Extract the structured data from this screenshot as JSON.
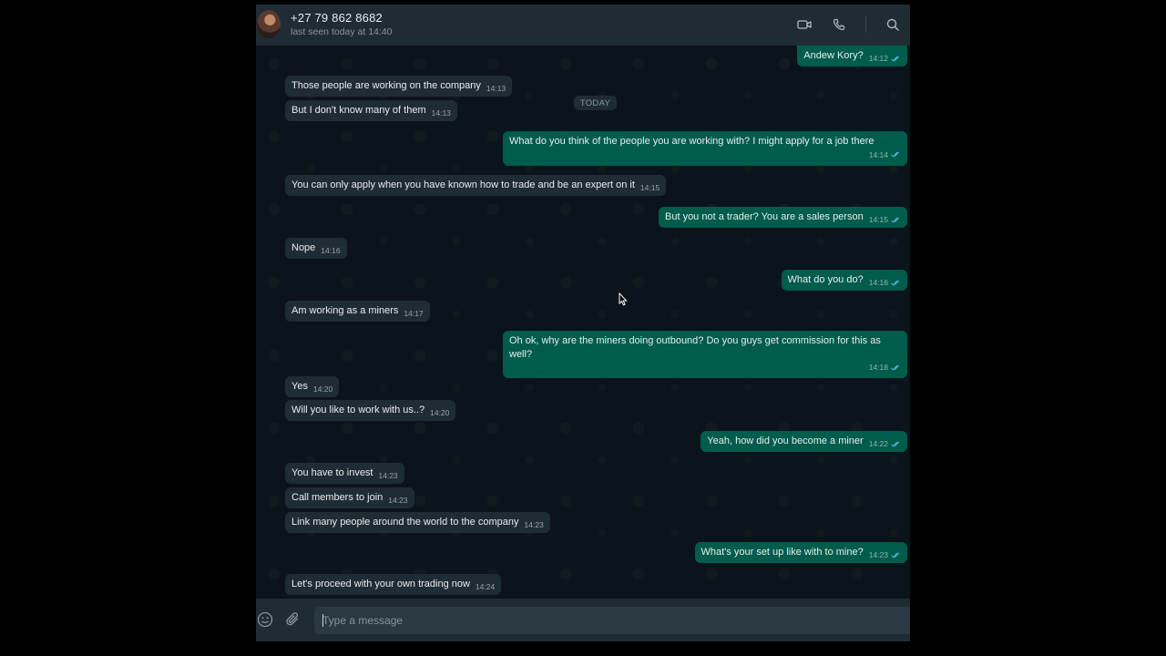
{
  "header": {
    "contact_name": "+27 79 862 8682",
    "status": "last seen today at 14:40",
    "icons": [
      "video-call-icon",
      "voice-call-icon",
      "search-icon"
    ]
  },
  "chat": {
    "date_chip": "TODAY",
    "messages": [
      {
        "dir": "out",
        "text": "Andew Kory?",
        "time": "14:12"
      },
      {
        "dir": "in",
        "text": "Those people are working on the company",
        "time": "14:13"
      },
      {
        "dir": "in",
        "text": "But I don't know many of them",
        "time": "14:13"
      },
      {
        "dir": "out",
        "text": "What do you think of the people you are working with? I might apply for a job there",
        "time": "14:14"
      },
      {
        "dir": "in",
        "text": "You can only apply when you have known how to trade and be an expert on it",
        "time": "14:15"
      },
      {
        "dir": "out",
        "text": "But you not a trader? You are a sales person",
        "time": "14:15"
      },
      {
        "dir": "in",
        "text": "Nope",
        "time": "14:16"
      },
      {
        "dir": "out",
        "text": "What do you do?",
        "time": "14:16"
      },
      {
        "dir": "in",
        "text": "Am working as a miners",
        "time": "14:17"
      },
      {
        "dir": "out",
        "text": "Oh ok, why are the miners doing outbound? Do you guys get commission for this as well?",
        "time": "14:18"
      },
      {
        "dir": "in",
        "text": "Yes",
        "time": "14:20"
      },
      {
        "dir": "in",
        "text": "Will you like to work with us..?",
        "time": "14:20"
      },
      {
        "dir": "out",
        "text": "Yeah, how did you become a miner",
        "time": "14:22"
      },
      {
        "dir": "in",
        "text": "You have to invest",
        "time": "14:23"
      },
      {
        "dir": "in",
        "text": "Call members to join",
        "time": "14:23"
      },
      {
        "dir": "in",
        "text": "Link many people around the world to the company",
        "time": "14:23"
      },
      {
        "dir": "out",
        "text": "What's your set up like with to mine?",
        "time": "14:23"
      },
      {
        "dir": "in",
        "text": "Let's proceed with your own trading now",
        "time": "14:24"
      }
    ]
  },
  "composer": {
    "placeholder": "Type a message",
    "icons": [
      "emoji-icon",
      "attach-icon"
    ]
  },
  "colors": {
    "incoming_bubble": "#1f2c33",
    "outgoing_bubble": "#005c4b",
    "background": "#0b141a",
    "read_ticks": "#53bdeb"
  }
}
